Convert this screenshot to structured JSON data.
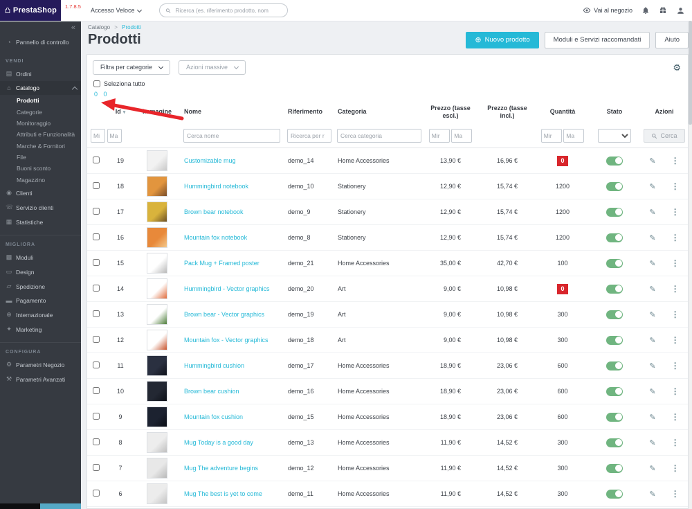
{
  "colors": {
    "accent": "#25b9d7",
    "success": "#70b580",
    "danger": "#d8262c",
    "annotation": "#e8252a",
    "logo-bg": "#251b5b",
    "sidebar-bg": "#363a41",
    "version": "#e53935"
  },
  "header": {
    "logo_text": "PrestaShop",
    "version": "1.7.8.5",
    "quick_access_label": "Accesso Veloce",
    "search_placeholder": "Ricerca (es. riferimento prodotto, nom",
    "view_shop_label": "Vai al negozio"
  },
  "sidebar": {
    "collapse_glyph": "«",
    "dashboard_label": "Pannello di controllo",
    "sections": [
      {
        "title": "VENDI",
        "items": [
          {
            "label": "Ordini",
            "icon": "orders-icon"
          },
          {
            "label": "Catalogo",
            "icon": "catalog-icon",
            "active": true,
            "expanded": true,
            "children": [
              "Prodotti",
              "Categorie",
              "Monitoraggio",
              "Attributi e Funzionalità",
              "Marche & Fornitori",
              "File",
              "Buoni sconto",
              "Magazzino"
            ],
            "active_child": "Prodotti"
          },
          {
            "label": "Clienti",
            "icon": "customers-icon"
          },
          {
            "label": "Servizio clienti",
            "icon": "customer-service-icon"
          },
          {
            "label": "Statistiche",
            "icon": "stats-icon"
          }
        ]
      },
      {
        "title": "MIGLIORA",
        "items": [
          {
            "label": "Moduli",
            "icon": "modules-icon"
          },
          {
            "label": "Design",
            "icon": "design-icon"
          },
          {
            "label": "Spedizione",
            "icon": "shipping-icon"
          },
          {
            "label": "Pagamento",
            "icon": "payment-icon"
          },
          {
            "label": "Internazionale",
            "icon": "international-icon"
          },
          {
            "label": "Marketing",
            "icon": "marketing-icon"
          }
        ]
      },
      {
        "title": "CONFIGURA",
        "items": [
          {
            "label": "Parametri Negozio",
            "icon": "shop-params-icon"
          },
          {
            "label": "Parametri Avanzati",
            "icon": "advanced-params-icon"
          }
        ]
      }
    ]
  },
  "breadcrumb": {
    "parent": "Catalogo",
    "current": "Prodotti"
  },
  "page": {
    "title": "Prodotti",
    "new_product_label": "Nuovo prodotto",
    "modules_label": "Moduli e Servizi raccomandati",
    "help_label": "Aiuto"
  },
  "toolbar": {
    "filter_by_category_label": "Filtra per categorie",
    "bulk_actions_label": "Azioni massive",
    "select_all_label": "Seleziona tutto",
    "annotation_text": "0 0"
  },
  "table": {
    "columns": [
      "Id",
      "Immagine",
      "Nome",
      "Riferimento",
      "Categoria",
      "Prezzo (tasse escl.)",
      "Prezzo (tasse incl.)",
      "Quantità",
      "Stato",
      "Azioni"
    ],
    "filters": {
      "id_min_placeholder": "Mi",
      "id_max_placeholder": "Ma",
      "name_placeholder": "Cerca nome",
      "reference_placeholder": "Ricerca per r",
      "category_placeholder": "Cerca categoria",
      "price_min_placeholder": "Mir",
      "price_max_placeholder": "Ma",
      "qty_min_placeholder": "Mir",
      "qty_max_placeholder": "Ma",
      "status_filter_value": "",
      "search_button_label": "Cerca"
    },
    "rows": [
      {
        "id": "19",
        "name": "Customizable mug",
        "reference": "demo_14",
        "category": "Home Accessories",
        "price_excl": "13,90 €",
        "price_incl": "16,96 €",
        "qty": "0",
        "qty_zero": true,
        "active": true,
        "thumb": {
          "base": "#f2f2f2",
          "accent": "#c9c9c9"
        }
      },
      {
        "id": "18",
        "name": "Hummingbird notebook",
        "reference": "demo_10",
        "category": "Stationery",
        "price_excl": "12,90 €",
        "price_incl": "15,74 €",
        "qty": "1200",
        "qty_zero": false,
        "active": true,
        "thumb": {
          "base": "#e2953e",
          "accent": "#7a4e2a"
        }
      },
      {
        "id": "17",
        "name": "Brown bear notebook",
        "reference": "demo_9",
        "category": "Stationery",
        "price_excl": "12,90 €",
        "price_incl": "15,74 €",
        "qty": "1200",
        "qty_zero": false,
        "active": true,
        "thumb": {
          "base": "#d9b33c",
          "accent": "#6e5225"
        }
      },
      {
        "id": "16",
        "name": "Mountain fox notebook",
        "reference": "demo_8",
        "category": "Stationery",
        "price_excl": "12,90 €",
        "price_incl": "15,74 €",
        "qty": "1200",
        "qty_zero": false,
        "active": true,
        "thumb": {
          "base": "#e8893a",
          "accent": "#f3c98c"
        }
      },
      {
        "id": "15",
        "name": "Pack Mug + Framed poster",
        "reference": "demo_21",
        "category": "Home Accessories",
        "price_excl": "35,00 €",
        "price_incl": "42,70 €",
        "qty": "100",
        "qty_zero": false,
        "active": true,
        "thumb": {
          "base": "#ffffff",
          "accent": "#b9b9b9"
        }
      },
      {
        "id": "14",
        "name": "Hummingbird - Vector graphics",
        "reference": "demo_20",
        "category": "Art",
        "price_excl": "9,00 €",
        "price_incl": "10,98 €",
        "qty": "0",
        "qty_zero": true,
        "active": true,
        "thumb": {
          "base": "#ffffff",
          "accent": "#e06c3c"
        }
      },
      {
        "id": "13",
        "name": "Brown bear - Vector graphics",
        "reference": "demo_19",
        "category": "Art",
        "price_excl": "9,00 €",
        "price_incl": "10,98 €",
        "qty": "300",
        "qty_zero": false,
        "active": true,
        "thumb": {
          "base": "#ffffff",
          "accent": "#4e7d3a"
        }
      },
      {
        "id": "12",
        "name": "Mountain fox - Vector graphics",
        "reference": "demo_18",
        "category": "Art",
        "price_excl": "9,00 €",
        "price_incl": "10,98 €",
        "qty": "300",
        "qty_zero": false,
        "active": true,
        "thumb": {
          "base": "#ffffff",
          "accent": "#c9552e"
        }
      },
      {
        "id": "11",
        "name": "Hummingbird cushion",
        "reference": "demo_17",
        "category": "Home Accessories",
        "price_excl": "18,90 €",
        "price_incl": "23,06 €",
        "qty": "600",
        "qty_zero": false,
        "active": true,
        "thumb": {
          "base": "#2a3040",
          "accent": "#10131c"
        }
      },
      {
        "id": "10",
        "name": "Brown bear cushion",
        "reference": "demo_16",
        "category": "Home Accessories",
        "price_excl": "18,90 €",
        "price_incl": "23,06 €",
        "qty": "600",
        "qty_zero": false,
        "active": true,
        "thumb": {
          "base": "#232833",
          "accent": "#0e1118"
        }
      },
      {
        "id": "9",
        "name": "Mountain fox cushion",
        "reference": "demo_15",
        "category": "Home Accessories",
        "price_excl": "18,90 €",
        "price_incl": "23,06 €",
        "qty": "600",
        "qty_zero": false,
        "active": true,
        "thumb": {
          "base": "#1c2230",
          "accent": "#0b0e16"
        }
      },
      {
        "id": "8",
        "name": "Mug Today is a good day",
        "reference": "demo_13",
        "category": "Home Accessories",
        "price_excl": "11,90 €",
        "price_incl": "14,52 €",
        "qty": "300",
        "qty_zero": false,
        "active": true,
        "thumb": {
          "base": "#ededed",
          "accent": "#bfbfbf"
        }
      },
      {
        "id": "7",
        "name": "Mug The adventure begins",
        "reference": "demo_12",
        "category": "Home Accessories",
        "price_excl": "11,90 €",
        "price_incl": "14,52 €",
        "qty": "300",
        "qty_zero": false,
        "active": true,
        "thumb": {
          "base": "#e8e8e8",
          "accent": "#b9b9b9"
        }
      },
      {
        "id": "6",
        "name": "Mug The best is yet to come",
        "reference": "demo_11",
        "category": "Home Accessories",
        "price_excl": "11,90 €",
        "price_incl": "14,52 €",
        "qty": "300",
        "qty_zero": false,
        "active": true,
        "thumb": {
          "base": "#ececec",
          "accent": "#c4c4c4"
        }
      }
    ]
  }
}
